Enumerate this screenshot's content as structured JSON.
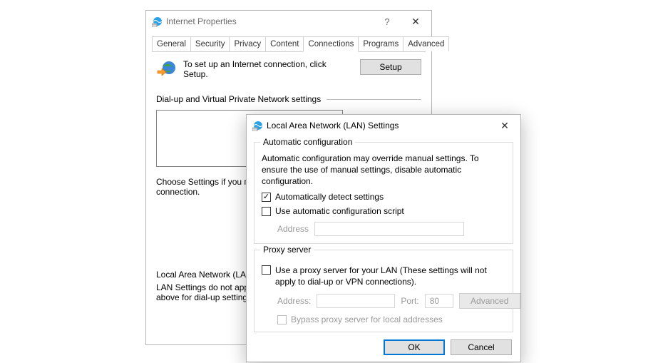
{
  "parent": {
    "title": "Internet Properties",
    "tabs": [
      "General",
      "Security",
      "Privacy",
      "Content",
      "Connections",
      "Programs",
      "Advanced"
    ],
    "active_tab": "Connections",
    "setup_text": "To set up an Internet connection, click Setup.",
    "setup_button": "Setup",
    "dialup_header": "Dial-up and Virtual Private Network settings",
    "choose_text": "Choose Settings if you need to configure a proxy server for a connection.",
    "lan_header": "Local Area Network (LAN) settings",
    "lan_text": "LAN Settings do not apply to dial-up connections. Choose Settings above for dial-up settings."
  },
  "child": {
    "title": "Local Area Network (LAN) Settings",
    "auto": {
      "legend": "Automatic configuration",
      "desc": "Automatic configuration may override manual settings.  To ensure the use of manual settings, disable automatic configuration.",
      "detect_label": "Automatically detect settings",
      "detect_checked": true,
      "script_label": "Use automatic configuration script",
      "script_checked": false,
      "address_label": "Address"
    },
    "proxy": {
      "legend": "Proxy server",
      "use_label": "Use a proxy server for your LAN (These settings will not apply to dial-up or VPN connections).",
      "use_checked": false,
      "address_label": "Address:",
      "address_value": "",
      "port_label": "Port:",
      "port_value": "80",
      "advanced_button": "Advanced",
      "bypass_label": "Bypass proxy server for local addresses",
      "bypass_checked": false
    },
    "ok": "OK",
    "cancel": "Cancel"
  }
}
